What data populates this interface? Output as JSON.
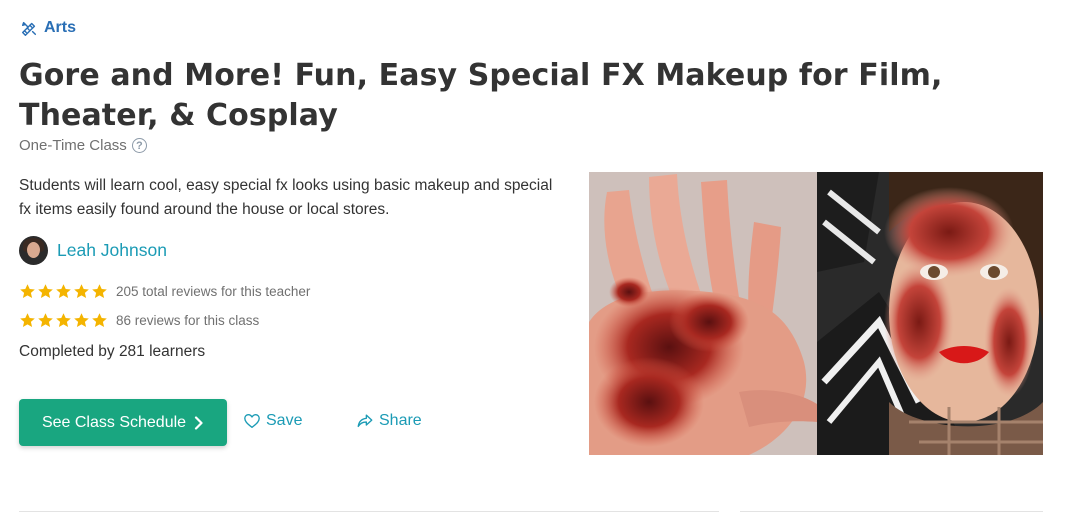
{
  "category": {
    "label": "Arts",
    "icon": "brush-ruler-icon",
    "color": "#2a6fb5"
  },
  "title": "Gore and More! Fun, Easy Special FX Makeup for Film, Theater, & Cosplay",
  "class_type": {
    "label": "One-Time Class",
    "help_icon": "question-circle-icon"
  },
  "summary": "Students will learn cool, easy special fx looks using basic makeup and special fx items easily found around the house or local stores.",
  "teacher": {
    "name": "Leah Johnson",
    "avatar": "teacher-avatar"
  },
  "ratings": [
    {
      "stars": 5,
      "text": "205 total reviews for this teacher"
    },
    {
      "stars": 5,
      "text": "86 reviews for this class"
    }
  ],
  "completed": "Completed by 281 learners",
  "actions": {
    "cta_label": "See Class Schedule",
    "cta_icon": "chevron-right-icon",
    "save_label": "Save",
    "save_icon": "heart-outline-icon",
    "share_label": "Share",
    "share_icon": "share-arrow-icon"
  },
  "colors": {
    "accent": "#19a680",
    "link": "#1b9bb5",
    "star": "#f4b400",
    "category": "#2a6fb5"
  },
  "hero_image": {
    "description_icon": "special-fx-makeup-photo"
  }
}
